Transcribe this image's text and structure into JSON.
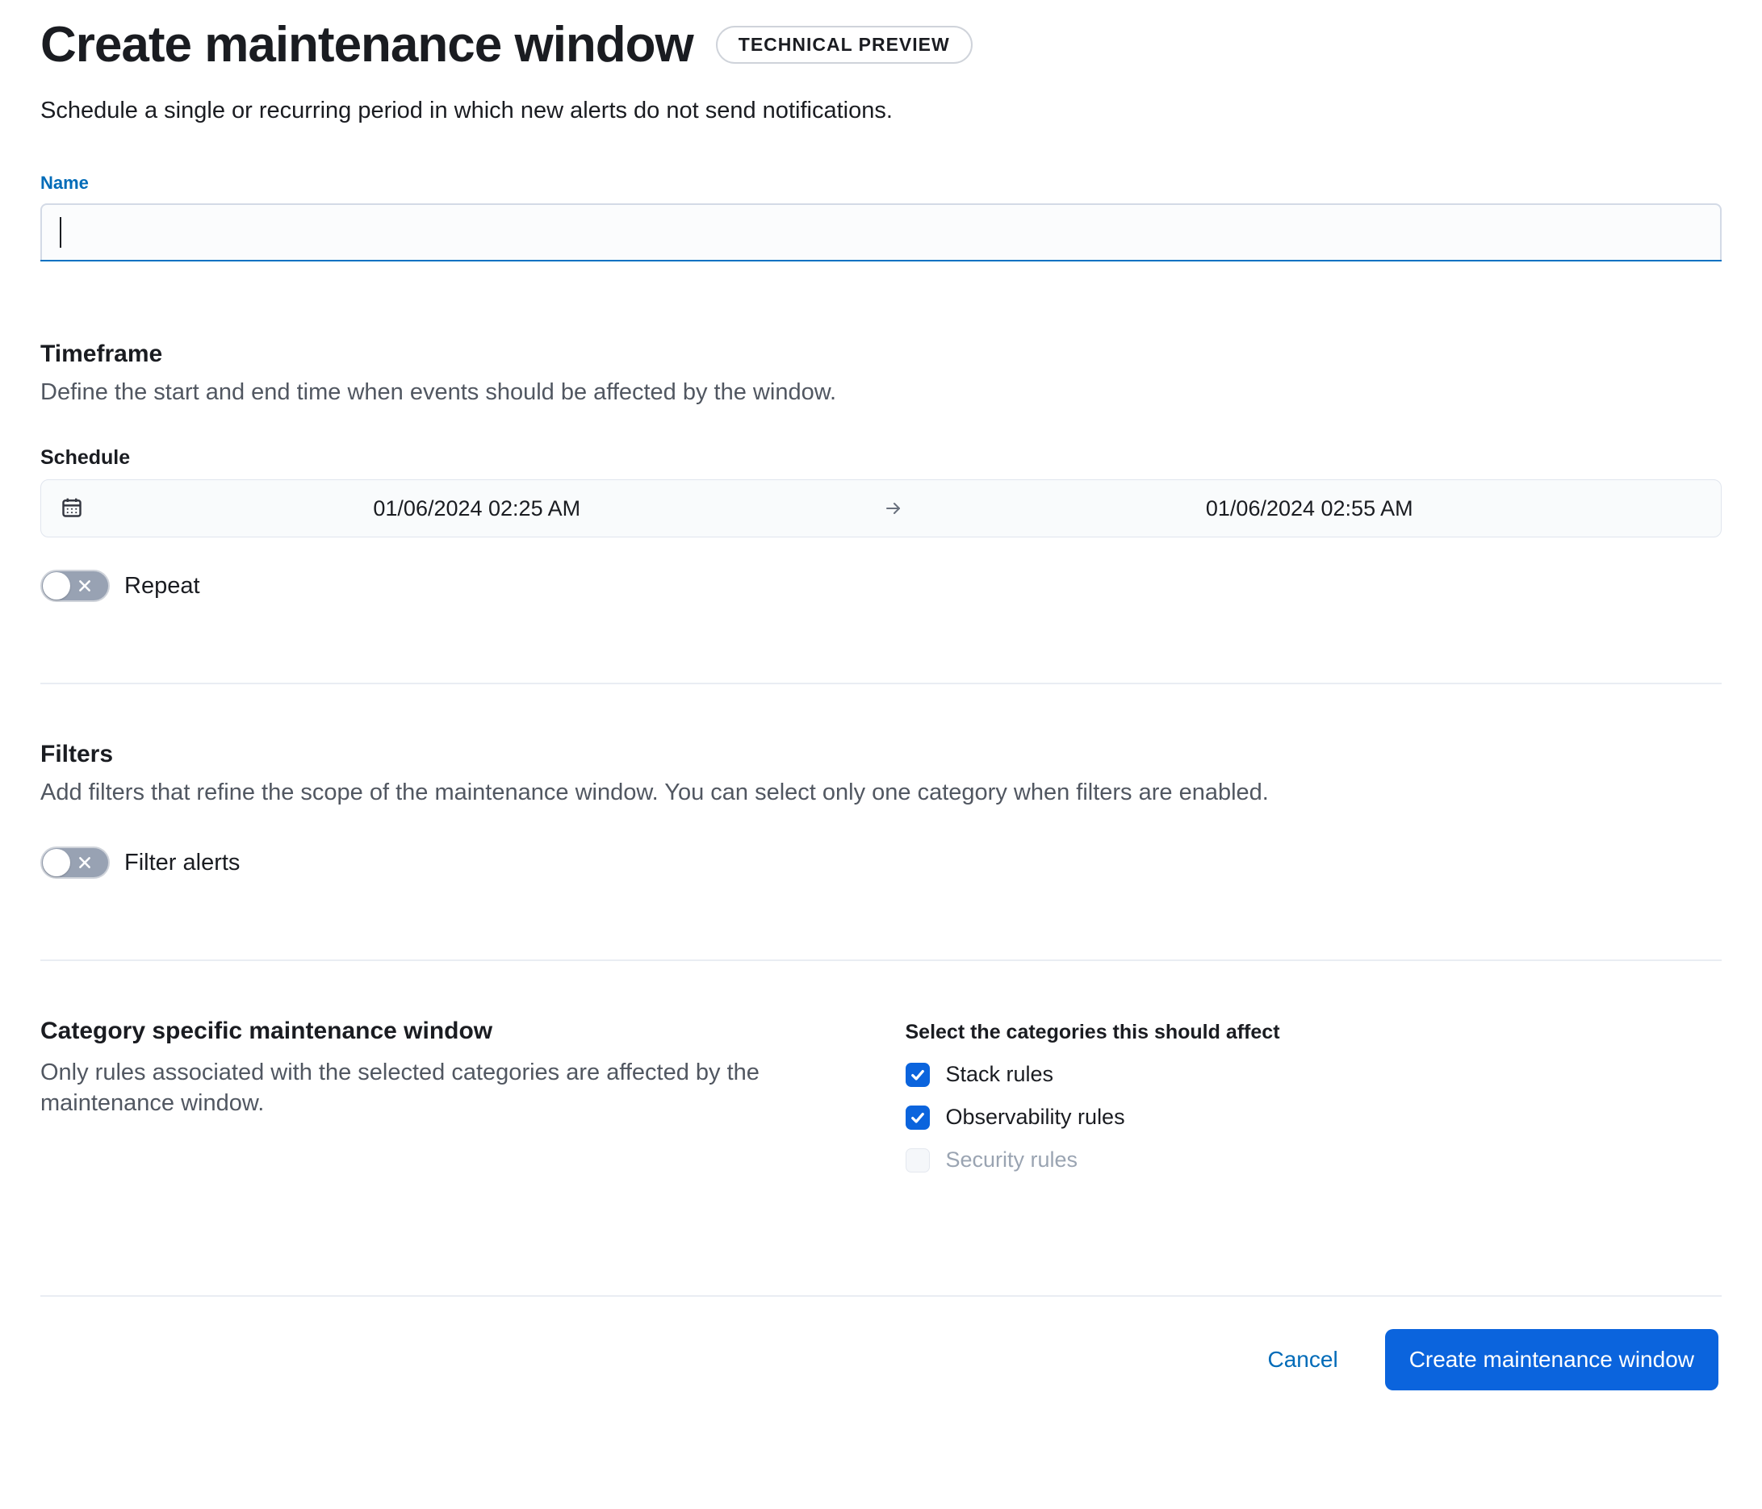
{
  "header": {
    "title": "Create maintenance window",
    "badge": "TECHNICAL PREVIEW",
    "subtitle": "Schedule a single or recurring period in which new alerts do not send notifications."
  },
  "name_field": {
    "label": "Name",
    "value": ""
  },
  "timeframe": {
    "heading": "Timeframe",
    "description": "Define the start and end time when events should be affected by the window.",
    "schedule_label": "Schedule",
    "start": "01/06/2024 02:25 AM",
    "end": "01/06/2024 02:55 AM",
    "repeat_label": "Repeat",
    "repeat_on": false
  },
  "filters": {
    "heading": "Filters",
    "description": "Add filters that refine the scope of the maintenance window. You can select only one category when filters are enabled.",
    "toggle_label": "Filter alerts",
    "toggle_on": false
  },
  "categories": {
    "heading": "Category specific maintenance window",
    "description": "Only rules associated with the selected categories are affected by the maintenance window.",
    "select_label": "Select the categories this should affect",
    "items": [
      {
        "label": "Stack rules",
        "checked": true,
        "disabled": false
      },
      {
        "label": "Observability rules",
        "checked": true,
        "disabled": false
      },
      {
        "label": "Security rules",
        "checked": false,
        "disabled": true
      }
    ]
  },
  "footer": {
    "cancel": "Cancel",
    "submit": "Create maintenance window"
  }
}
